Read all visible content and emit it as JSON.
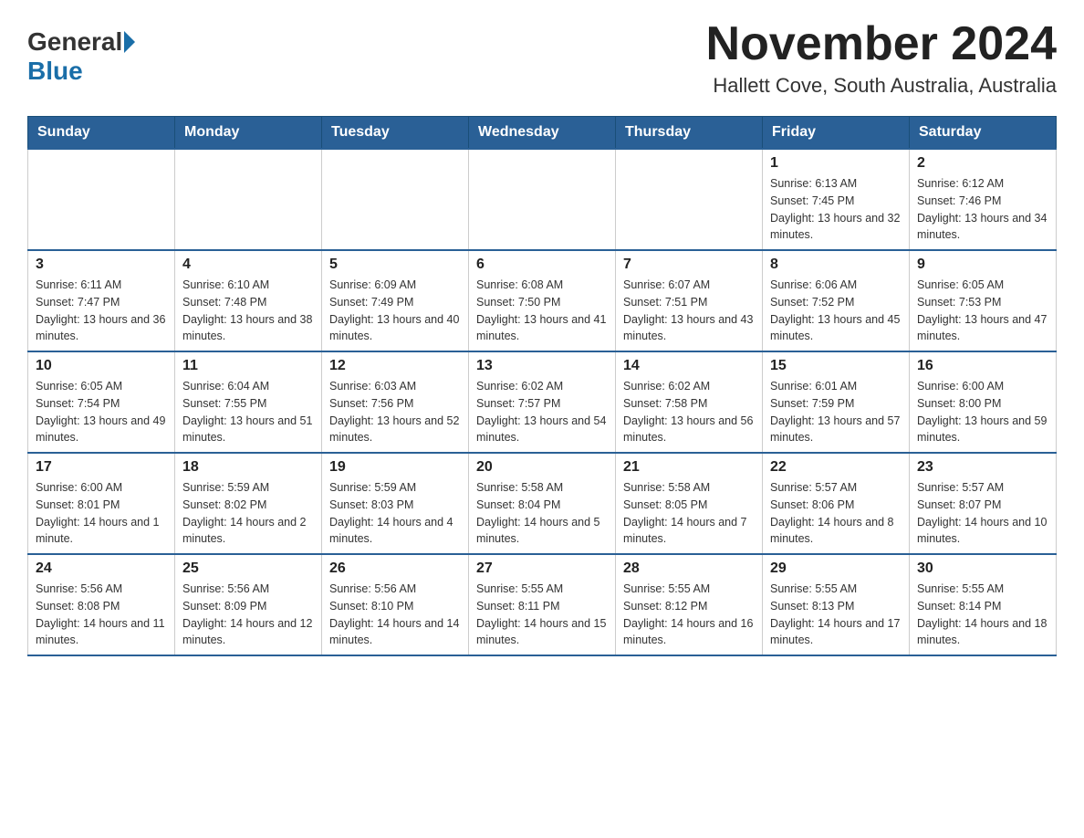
{
  "header": {
    "logo_general": "General",
    "logo_blue": "Blue",
    "month_title": "November 2024",
    "location": "Hallett Cove, South Australia, Australia"
  },
  "weekdays": [
    "Sunday",
    "Monday",
    "Tuesday",
    "Wednesday",
    "Thursday",
    "Friday",
    "Saturday"
  ],
  "weeks": [
    [
      {
        "day": "",
        "sunrise": "",
        "sunset": "",
        "daylight": ""
      },
      {
        "day": "",
        "sunrise": "",
        "sunset": "",
        "daylight": ""
      },
      {
        "day": "",
        "sunrise": "",
        "sunset": "",
        "daylight": ""
      },
      {
        "day": "",
        "sunrise": "",
        "sunset": "",
        "daylight": ""
      },
      {
        "day": "",
        "sunrise": "",
        "sunset": "",
        "daylight": ""
      },
      {
        "day": "1",
        "sunrise": "Sunrise: 6:13 AM",
        "sunset": "Sunset: 7:45 PM",
        "daylight": "Daylight: 13 hours and 32 minutes."
      },
      {
        "day": "2",
        "sunrise": "Sunrise: 6:12 AM",
        "sunset": "Sunset: 7:46 PM",
        "daylight": "Daylight: 13 hours and 34 minutes."
      }
    ],
    [
      {
        "day": "3",
        "sunrise": "Sunrise: 6:11 AM",
        "sunset": "Sunset: 7:47 PM",
        "daylight": "Daylight: 13 hours and 36 minutes."
      },
      {
        "day": "4",
        "sunrise": "Sunrise: 6:10 AM",
        "sunset": "Sunset: 7:48 PM",
        "daylight": "Daylight: 13 hours and 38 minutes."
      },
      {
        "day": "5",
        "sunrise": "Sunrise: 6:09 AM",
        "sunset": "Sunset: 7:49 PM",
        "daylight": "Daylight: 13 hours and 40 minutes."
      },
      {
        "day": "6",
        "sunrise": "Sunrise: 6:08 AM",
        "sunset": "Sunset: 7:50 PM",
        "daylight": "Daylight: 13 hours and 41 minutes."
      },
      {
        "day": "7",
        "sunrise": "Sunrise: 6:07 AM",
        "sunset": "Sunset: 7:51 PM",
        "daylight": "Daylight: 13 hours and 43 minutes."
      },
      {
        "day": "8",
        "sunrise": "Sunrise: 6:06 AM",
        "sunset": "Sunset: 7:52 PM",
        "daylight": "Daylight: 13 hours and 45 minutes."
      },
      {
        "day": "9",
        "sunrise": "Sunrise: 6:05 AM",
        "sunset": "Sunset: 7:53 PM",
        "daylight": "Daylight: 13 hours and 47 minutes."
      }
    ],
    [
      {
        "day": "10",
        "sunrise": "Sunrise: 6:05 AM",
        "sunset": "Sunset: 7:54 PM",
        "daylight": "Daylight: 13 hours and 49 minutes."
      },
      {
        "day": "11",
        "sunrise": "Sunrise: 6:04 AM",
        "sunset": "Sunset: 7:55 PM",
        "daylight": "Daylight: 13 hours and 51 minutes."
      },
      {
        "day": "12",
        "sunrise": "Sunrise: 6:03 AM",
        "sunset": "Sunset: 7:56 PM",
        "daylight": "Daylight: 13 hours and 52 minutes."
      },
      {
        "day": "13",
        "sunrise": "Sunrise: 6:02 AM",
        "sunset": "Sunset: 7:57 PM",
        "daylight": "Daylight: 13 hours and 54 minutes."
      },
      {
        "day": "14",
        "sunrise": "Sunrise: 6:02 AM",
        "sunset": "Sunset: 7:58 PM",
        "daylight": "Daylight: 13 hours and 56 minutes."
      },
      {
        "day": "15",
        "sunrise": "Sunrise: 6:01 AM",
        "sunset": "Sunset: 7:59 PM",
        "daylight": "Daylight: 13 hours and 57 minutes."
      },
      {
        "day": "16",
        "sunrise": "Sunrise: 6:00 AM",
        "sunset": "Sunset: 8:00 PM",
        "daylight": "Daylight: 13 hours and 59 minutes."
      }
    ],
    [
      {
        "day": "17",
        "sunrise": "Sunrise: 6:00 AM",
        "sunset": "Sunset: 8:01 PM",
        "daylight": "Daylight: 14 hours and 1 minute."
      },
      {
        "day": "18",
        "sunrise": "Sunrise: 5:59 AM",
        "sunset": "Sunset: 8:02 PM",
        "daylight": "Daylight: 14 hours and 2 minutes."
      },
      {
        "day": "19",
        "sunrise": "Sunrise: 5:59 AM",
        "sunset": "Sunset: 8:03 PM",
        "daylight": "Daylight: 14 hours and 4 minutes."
      },
      {
        "day": "20",
        "sunrise": "Sunrise: 5:58 AM",
        "sunset": "Sunset: 8:04 PM",
        "daylight": "Daylight: 14 hours and 5 minutes."
      },
      {
        "day": "21",
        "sunrise": "Sunrise: 5:58 AM",
        "sunset": "Sunset: 8:05 PM",
        "daylight": "Daylight: 14 hours and 7 minutes."
      },
      {
        "day": "22",
        "sunrise": "Sunrise: 5:57 AM",
        "sunset": "Sunset: 8:06 PM",
        "daylight": "Daylight: 14 hours and 8 minutes."
      },
      {
        "day": "23",
        "sunrise": "Sunrise: 5:57 AM",
        "sunset": "Sunset: 8:07 PM",
        "daylight": "Daylight: 14 hours and 10 minutes."
      }
    ],
    [
      {
        "day": "24",
        "sunrise": "Sunrise: 5:56 AM",
        "sunset": "Sunset: 8:08 PM",
        "daylight": "Daylight: 14 hours and 11 minutes."
      },
      {
        "day": "25",
        "sunrise": "Sunrise: 5:56 AM",
        "sunset": "Sunset: 8:09 PM",
        "daylight": "Daylight: 14 hours and 12 minutes."
      },
      {
        "day": "26",
        "sunrise": "Sunrise: 5:56 AM",
        "sunset": "Sunset: 8:10 PM",
        "daylight": "Daylight: 14 hours and 14 minutes."
      },
      {
        "day": "27",
        "sunrise": "Sunrise: 5:55 AM",
        "sunset": "Sunset: 8:11 PM",
        "daylight": "Daylight: 14 hours and 15 minutes."
      },
      {
        "day": "28",
        "sunrise": "Sunrise: 5:55 AM",
        "sunset": "Sunset: 8:12 PM",
        "daylight": "Daylight: 14 hours and 16 minutes."
      },
      {
        "day": "29",
        "sunrise": "Sunrise: 5:55 AM",
        "sunset": "Sunset: 8:13 PM",
        "daylight": "Daylight: 14 hours and 17 minutes."
      },
      {
        "day": "30",
        "sunrise": "Sunrise: 5:55 AM",
        "sunset": "Sunset: 8:14 PM",
        "daylight": "Daylight: 14 hours and 18 minutes."
      }
    ]
  ]
}
